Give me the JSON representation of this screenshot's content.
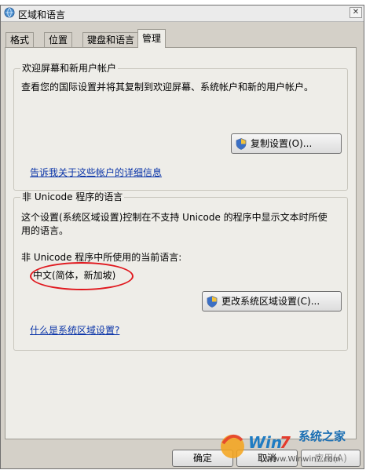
{
  "window": {
    "title": "区域和语言",
    "close_glyph": "✕"
  },
  "tabs": [
    {
      "label": "格式"
    },
    {
      "label": "位置"
    },
    {
      "label": "键盘和语言"
    },
    {
      "label": "管理",
      "active": true
    }
  ],
  "welcome_group": {
    "title": "欢迎屏幕和新用户帐户",
    "description": "查看您的国际设置并将其复制到欢迎屏幕、系统帐户和新的用户帐户。",
    "copy_button": "复制设置(O)...",
    "link": "告诉我关于这些帐户的详细信息"
  },
  "nonunicode_group": {
    "title": "非 Unicode 程序的语言",
    "description_line1": "这个设置(系统区域设置)控制在不支持 Unicode 的程序中显示文本时所使",
    "description_line2": "用的语言。",
    "current_label": "非 Unicode 程序中所使用的当前语言:",
    "current_value": "中文(简体，新加坡)",
    "change_button": "更改系统区域设置(C)...",
    "link": "什么是系统区域设置?"
  },
  "footer": {
    "ok": "确定",
    "cancel": "取消",
    "apply": "应用(A)"
  },
  "watermark": {
    "brand": "系统之家",
    "url": "Www.Winwin7.com"
  },
  "colors": {
    "highlight_circle": "#e0181e",
    "link": "#0a34a8",
    "dialog_bg": "#d4d0c8"
  }
}
